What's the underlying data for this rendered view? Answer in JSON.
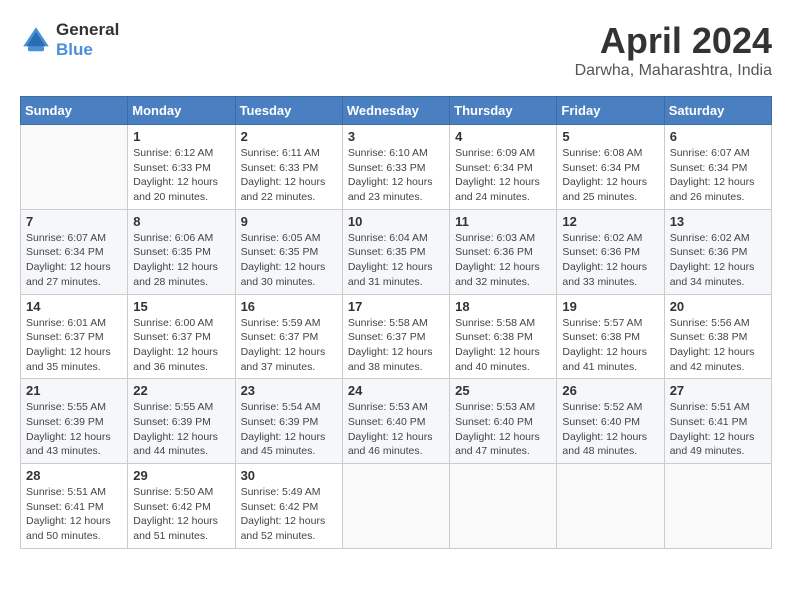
{
  "header": {
    "logo_line1": "General",
    "logo_line2": "Blue",
    "month": "April 2024",
    "location": "Darwha, Maharashtra, India"
  },
  "weekdays": [
    "Sunday",
    "Monday",
    "Tuesday",
    "Wednesday",
    "Thursday",
    "Friday",
    "Saturday"
  ],
  "weeks": [
    [
      {
        "day": "",
        "info": ""
      },
      {
        "day": "1",
        "info": "Sunrise: 6:12 AM\nSunset: 6:33 PM\nDaylight: 12 hours\nand 20 minutes."
      },
      {
        "day": "2",
        "info": "Sunrise: 6:11 AM\nSunset: 6:33 PM\nDaylight: 12 hours\nand 22 minutes."
      },
      {
        "day": "3",
        "info": "Sunrise: 6:10 AM\nSunset: 6:33 PM\nDaylight: 12 hours\nand 23 minutes."
      },
      {
        "day": "4",
        "info": "Sunrise: 6:09 AM\nSunset: 6:34 PM\nDaylight: 12 hours\nand 24 minutes."
      },
      {
        "day": "5",
        "info": "Sunrise: 6:08 AM\nSunset: 6:34 PM\nDaylight: 12 hours\nand 25 minutes."
      },
      {
        "day": "6",
        "info": "Sunrise: 6:07 AM\nSunset: 6:34 PM\nDaylight: 12 hours\nand 26 minutes."
      }
    ],
    [
      {
        "day": "7",
        "info": "Sunrise: 6:07 AM\nSunset: 6:34 PM\nDaylight: 12 hours\nand 27 minutes."
      },
      {
        "day": "8",
        "info": "Sunrise: 6:06 AM\nSunset: 6:35 PM\nDaylight: 12 hours\nand 28 minutes."
      },
      {
        "day": "9",
        "info": "Sunrise: 6:05 AM\nSunset: 6:35 PM\nDaylight: 12 hours\nand 30 minutes."
      },
      {
        "day": "10",
        "info": "Sunrise: 6:04 AM\nSunset: 6:35 PM\nDaylight: 12 hours\nand 31 minutes."
      },
      {
        "day": "11",
        "info": "Sunrise: 6:03 AM\nSunset: 6:36 PM\nDaylight: 12 hours\nand 32 minutes."
      },
      {
        "day": "12",
        "info": "Sunrise: 6:02 AM\nSunset: 6:36 PM\nDaylight: 12 hours\nand 33 minutes."
      },
      {
        "day": "13",
        "info": "Sunrise: 6:02 AM\nSunset: 6:36 PM\nDaylight: 12 hours\nand 34 minutes."
      }
    ],
    [
      {
        "day": "14",
        "info": "Sunrise: 6:01 AM\nSunset: 6:37 PM\nDaylight: 12 hours\nand 35 minutes."
      },
      {
        "day": "15",
        "info": "Sunrise: 6:00 AM\nSunset: 6:37 PM\nDaylight: 12 hours\nand 36 minutes."
      },
      {
        "day": "16",
        "info": "Sunrise: 5:59 AM\nSunset: 6:37 PM\nDaylight: 12 hours\nand 37 minutes."
      },
      {
        "day": "17",
        "info": "Sunrise: 5:58 AM\nSunset: 6:37 PM\nDaylight: 12 hours\nand 38 minutes."
      },
      {
        "day": "18",
        "info": "Sunrise: 5:58 AM\nSunset: 6:38 PM\nDaylight: 12 hours\nand 40 minutes."
      },
      {
        "day": "19",
        "info": "Sunrise: 5:57 AM\nSunset: 6:38 PM\nDaylight: 12 hours\nand 41 minutes."
      },
      {
        "day": "20",
        "info": "Sunrise: 5:56 AM\nSunset: 6:38 PM\nDaylight: 12 hours\nand 42 minutes."
      }
    ],
    [
      {
        "day": "21",
        "info": "Sunrise: 5:55 AM\nSunset: 6:39 PM\nDaylight: 12 hours\nand 43 minutes."
      },
      {
        "day": "22",
        "info": "Sunrise: 5:55 AM\nSunset: 6:39 PM\nDaylight: 12 hours\nand 44 minutes."
      },
      {
        "day": "23",
        "info": "Sunrise: 5:54 AM\nSunset: 6:39 PM\nDaylight: 12 hours\nand 45 minutes."
      },
      {
        "day": "24",
        "info": "Sunrise: 5:53 AM\nSunset: 6:40 PM\nDaylight: 12 hours\nand 46 minutes."
      },
      {
        "day": "25",
        "info": "Sunrise: 5:53 AM\nSunset: 6:40 PM\nDaylight: 12 hours\nand 47 minutes."
      },
      {
        "day": "26",
        "info": "Sunrise: 5:52 AM\nSunset: 6:40 PM\nDaylight: 12 hours\nand 48 minutes."
      },
      {
        "day": "27",
        "info": "Sunrise: 5:51 AM\nSunset: 6:41 PM\nDaylight: 12 hours\nand 49 minutes."
      }
    ],
    [
      {
        "day": "28",
        "info": "Sunrise: 5:51 AM\nSunset: 6:41 PM\nDaylight: 12 hours\nand 50 minutes."
      },
      {
        "day": "29",
        "info": "Sunrise: 5:50 AM\nSunset: 6:42 PM\nDaylight: 12 hours\nand 51 minutes."
      },
      {
        "day": "30",
        "info": "Sunrise: 5:49 AM\nSunset: 6:42 PM\nDaylight: 12 hours\nand 52 minutes."
      },
      {
        "day": "",
        "info": ""
      },
      {
        "day": "",
        "info": ""
      },
      {
        "day": "",
        "info": ""
      },
      {
        "day": "",
        "info": ""
      }
    ]
  ]
}
